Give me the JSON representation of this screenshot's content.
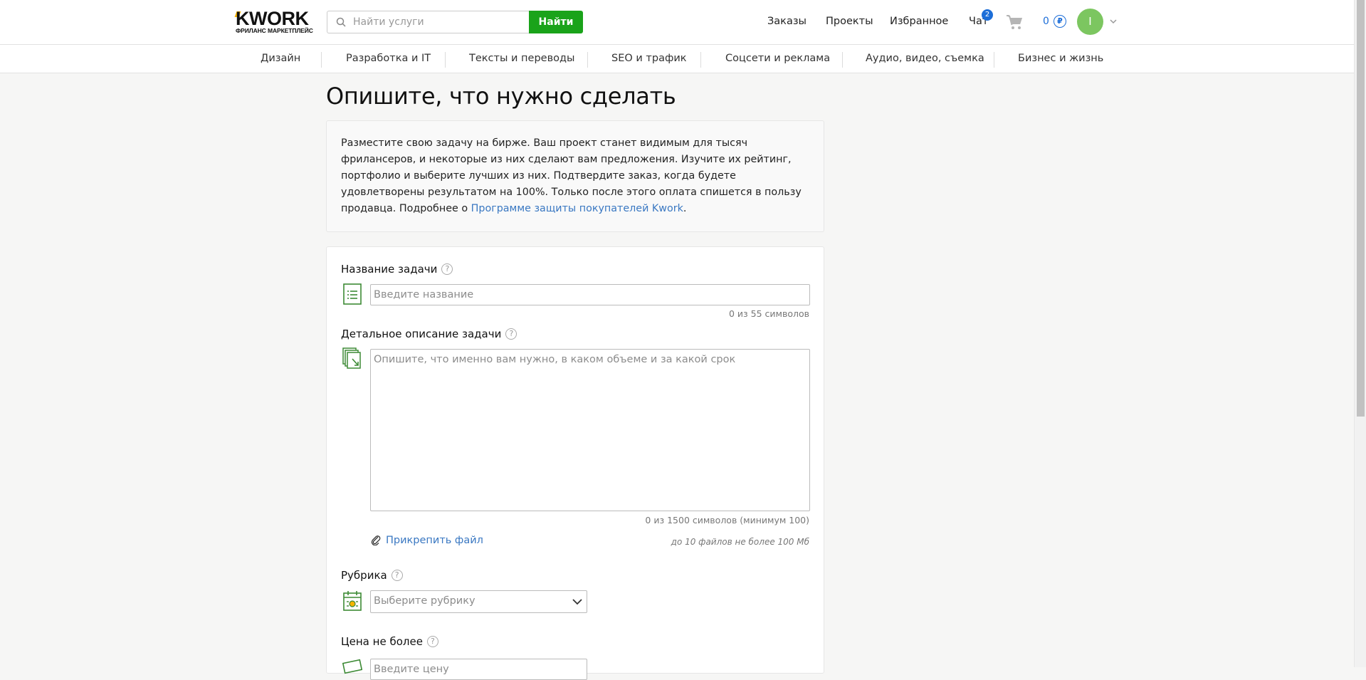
{
  "header": {
    "logo_text": "KWORK",
    "logo_sub": "ФРИЛАНС МАРКЕТПЛЕЙС",
    "search_placeholder": "Найти услуги",
    "search_button": "Найти",
    "nav": {
      "orders": "Заказы",
      "projects": "Проекты",
      "favorites": "Избранное",
      "chat": "Чат",
      "chat_badge": "2"
    },
    "balance": "0",
    "currency_symbol": "₽",
    "avatar_letter": "I"
  },
  "categories": [
    "Дизайн",
    "Разработка и IT",
    "Тексты и переводы",
    "SEO и трафик",
    "Соцсети и реклама",
    "Аудио, видео, съемка",
    "Бизнес и жизнь"
  ],
  "main": {
    "title": "Опишите, что нужно сделать",
    "info_text": "Разместите свою задачу на бирже. Ваш проект станет видимым для тысяч фрилансеров, и некоторые из них сделают вам предложения. Изучите их рейтинг, портфолио и выберите лучших из них. Подтвердите заказ, когда будете удовлетворены результатом на 100%. Только после этого оплата спишется в пользу продавца. Подробнее о ",
    "info_link": "Программе защиты покупателей Kwork",
    "info_end": "."
  },
  "form": {
    "help_glyph": "?",
    "task_name_label": "Название задачи",
    "task_name_placeholder": "Введите название",
    "task_name_counter": "0 из 55 символов",
    "description_label": "Детальное описание задачи",
    "description_placeholder": "Опишите, что именно вам нужно, в каком объеме и за какой срок",
    "description_counter": "0 из 1500 символов (минимум 100)",
    "attach_label": "Прикрепить файл",
    "attach_note": "до 10 файлов не более 100 Мб",
    "category_label": "Рубрика",
    "category_placeholder": "Выберите рубрику",
    "price_label": "Цена не более",
    "price_placeholder": "Введите цену"
  },
  "colors": {
    "brand_green": "#1aa31a",
    "link_blue": "#3a78c2",
    "icon_green": "#3d8a35"
  }
}
